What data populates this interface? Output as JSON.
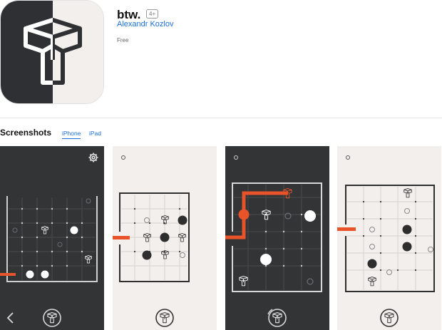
{
  "app": {
    "title": "btw.",
    "age_rating": "4+",
    "developer": "Alexandr Kozlov",
    "price": "Free",
    "icon": "btw-logo-icon"
  },
  "screenshots": {
    "heading": "Screenshots",
    "tabs": [
      {
        "label": "iPhone",
        "selected": true
      },
      {
        "label": "iPad",
        "selected": false
      }
    ],
    "items": [
      {
        "theme": "dark",
        "icons": [
          "gear-icon",
          "back-chevron-icon",
          "btw-logo-icon"
        ]
      },
      {
        "theme": "light",
        "icons": [
          "btw-logo-icon"
        ]
      },
      {
        "theme": "dark",
        "icons": [
          "restart-icon",
          "btw-logo-icon"
        ]
      },
      {
        "theme": "light",
        "icons": [
          "btw-logo-icon"
        ]
      }
    ]
  },
  "colors": {
    "dark_bg": "#333436",
    "light_bg": "#f3efed",
    "accent": "#e8532a",
    "link": "#1a6fd6"
  }
}
